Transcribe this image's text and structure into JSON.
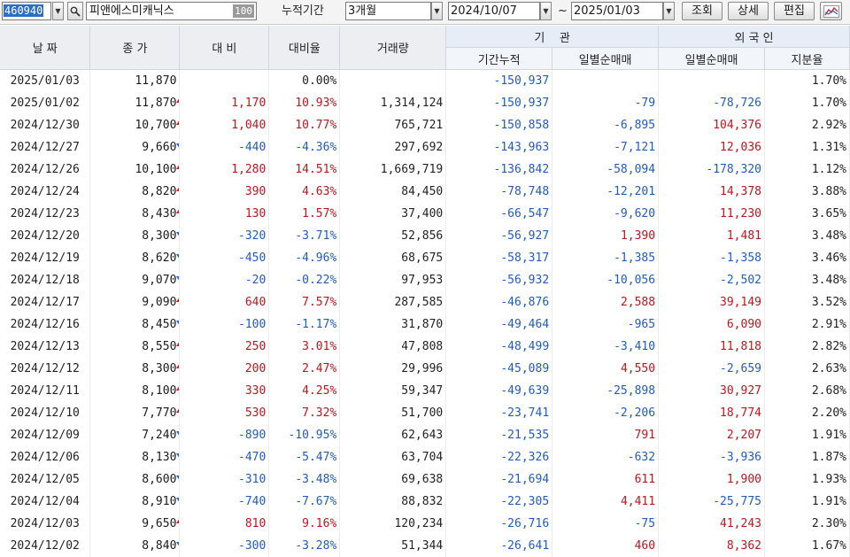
{
  "toolbar": {
    "code": "460940",
    "name": "피앤에스미캐닉스",
    "count": "100",
    "period_label": "누적기간",
    "period": "3개월",
    "start_date": "2024/10/07",
    "tilde": "~",
    "end_date": "2025/01/03",
    "buttons": {
      "query": "조회",
      "detail": "상세",
      "edit": "편집"
    },
    "icons": {
      "dropdown": "chevron-down-icon",
      "search": "magnifier-icon",
      "chart": "line-chart-icon"
    }
  },
  "headers": {
    "date": "날 짜",
    "close": "종 가",
    "change": "대 비",
    "rate": "대비율",
    "volume": "거래량",
    "inst_group": "기    관",
    "inst_cum": "기간누적",
    "inst_daily": "일별순매매",
    "foreign_group": "외 국 인",
    "foreign_daily": "일별순매매",
    "foreign_share": "지분율"
  },
  "colors": {
    "up": "#c3141c",
    "down": "#1f5bc3",
    "header_bg": "#eceef2"
  },
  "rows": [
    {
      "date": "2025/01/03",
      "close": "11,870",
      "dir": "none",
      "change": "",
      "rate": "0.00%",
      "volume": "",
      "inst_cum": "-150,937",
      "inst_daily": "",
      "foreign_daily": "",
      "share": "1.70%"
    },
    {
      "date": "2025/01/02",
      "close": "11,870",
      "dir": "up",
      "change": "1,170",
      "rate": "10.93%",
      "volume": "1,314,124",
      "inst_cum": "-150,937",
      "inst_daily": "-79",
      "foreign_daily": "-78,726",
      "share": "1.70%"
    },
    {
      "date": "2024/12/30",
      "close": "10,700",
      "dir": "up",
      "change": "1,040",
      "rate": "10.77%",
      "volume": "765,721",
      "inst_cum": "-150,858",
      "inst_daily": "-6,895",
      "foreign_daily": "104,376",
      "share": "2.92%"
    },
    {
      "date": "2024/12/27",
      "close": "9,660",
      "dir": "down",
      "change": "-440",
      "rate": "-4.36%",
      "volume": "297,692",
      "inst_cum": "-143,963",
      "inst_daily": "-7,121",
      "foreign_daily": "12,036",
      "share": "1.31%"
    },
    {
      "date": "2024/12/26",
      "close": "10,100",
      "dir": "up",
      "change": "1,280",
      "rate": "14.51%",
      "volume": "1,669,719",
      "inst_cum": "-136,842",
      "inst_daily": "-58,094",
      "foreign_daily": "-178,320",
      "share": "1.12%"
    },
    {
      "date": "2024/12/24",
      "close": "8,820",
      "dir": "up",
      "change": "390",
      "rate": "4.63%",
      "volume": "84,450",
      "inst_cum": "-78,748",
      "inst_daily": "-12,201",
      "foreign_daily": "14,378",
      "share": "3.88%"
    },
    {
      "date": "2024/12/23",
      "close": "8,430",
      "dir": "up",
      "change": "130",
      "rate": "1.57%",
      "volume": "37,400",
      "inst_cum": "-66,547",
      "inst_daily": "-9,620",
      "foreign_daily": "11,230",
      "share": "3.65%"
    },
    {
      "date": "2024/12/20",
      "close": "8,300",
      "dir": "down",
      "change": "-320",
      "rate": "-3.71%",
      "volume": "52,856",
      "inst_cum": "-56,927",
      "inst_daily": "1,390",
      "foreign_daily": "1,481",
      "share": "3.48%"
    },
    {
      "date": "2024/12/19",
      "close": "8,620",
      "dir": "down",
      "change": "-450",
      "rate": "-4.96%",
      "volume": "68,675",
      "inst_cum": "-58,317",
      "inst_daily": "-1,385",
      "foreign_daily": "-1,358",
      "share": "3.46%"
    },
    {
      "date": "2024/12/18",
      "close": "9,070",
      "dir": "down",
      "change": "-20",
      "rate": "-0.22%",
      "volume": "97,953",
      "inst_cum": "-56,932",
      "inst_daily": "-10,056",
      "foreign_daily": "-2,502",
      "share": "3.48%"
    },
    {
      "date": "2024/12/17",
      "close": "9,090",
      "dir": "up",
      "change": "640",
      "rate": "7.57%",
      "volume": "287,585",
      "inst_cum": "-46,876",
      "inst_daily": "2,588",
      "foreign_daily": "39,149",
      "share": "3.52%"
    },
    {
      "date": "2024/12/16",
      "close": "8,450",
      "dir": "down",
      "change": "-100",
      "rate": "-1.17%",
      "volume": "31,870",
      "inst_cum": "-49,464",
      "inst_daily": "-965",
      "foreign_daily": "6,090",
      "share": "2.91%"
    },
    {
      "date": "2024/12/13",
      "close": "8,550",
      "dir": "up",
      "change": "250",
      "rate": "3.01%",
      "volume": "47,808",
      "inst_cum": "-48,499",
      "inst_daily": "-3,410",
      "foreign_daily": "11,818",
      "share": "2.82%"
    },
    {
      "date": "2024/12/12",
      "close": "8,300",
      "dir": "up",
      "change": "200",
      "rate": "2.47%",
      "volume": "29,996",
      "inst_cum": "-45,089",
      "inst_daily": "4,550",
      "foreign_daily": "-2,659",
      "share": "2.63%"
    },
    {
      "date": "2024/12/11",
      "close": "8,100",
      "dir": "up",
      "change": "330",
      "rate": "4.25%",
      "volume": "59,347",
      "inst_cum": "-49,639",
      "inst_daily": "-25,898",
      "foreign_daily": "30,927",
      "share": "2.68%"
    },
    {
      "date": "2024/12/10",
      "close": "7,770",
      "dir": "up",
      "change": "530",
      "rate": "7.32%",
      "volume": "51,700",
      "inst_cum": "-23,741",
      "inst_daily": "-2,206",
      "foreign_daily": "18,774",
      "share": "2.20%"
    },
    {
      "date": "2024/12/09",
      "close": "7,240",
      "dir": "down",
      "change": "-890",
      "rate": "-10.95%",
      "volume": "62,643",
      "inst_cum": "-21,535",
      "inst_daily": "791",
      "foreign_daily": "2,207",
      "share": "1.91%"
    },
    {
      "date": "2024/12/06",
      "close": "8,130",
      "dir": "down",
      "change": "-470",
      "rate": "-5.47%",
      "volume": "63,704",
      "inst_cum": "-22,326",
      "inst_daily": "-632",
      "foreign_daily": "-3,936",
      "share": "1.87%"
    },
    {
      "date": "2024/12/05",
      "close": "8,600",
      "dir": "down",
      "change": "-310",
      "rate": "-3.48%",
      "volume": "69,638",
      "inst_cum": "-21,694",
      "inst_daily": "611",
      "foreign_daily": "1,900",
      "share": "1.93%"
    },
    {
      "date": "2024/12/04",
      "close": "8,910",
      "dir": "down",
      "change": "-740",
      "rate": "-7.67%",
      "volume": "88,832",
      "inst_cum": "-22,305",
      "inst_daily": "4,411",
      "foreign_daily": "-25,775",
      "share": "1.91%"
    },
    {
      "date": "2024/12/03",
      "close": "9,650",
      "dir": "up",
      "change": "810",
      "rate": "9.16%",
      "volume": "120,234",
      "inst_cum": "-26,716",
      "inst_daily": "-75",
      "foreign_daily": "41,243",
      "share": "2.30%"
    },
    {
      "date": "2024/12/02",
      "close": "8,840",
      "dir": "down",
      "change": "-300",
      "rate": "-3.28%",
      "volume": "51,344",
      "inst_cum": "-26,641",
      "inst_daily": "460",
      "foreign_daily": "8,362",
      "share": "1.67%"
    }
  ]
}
